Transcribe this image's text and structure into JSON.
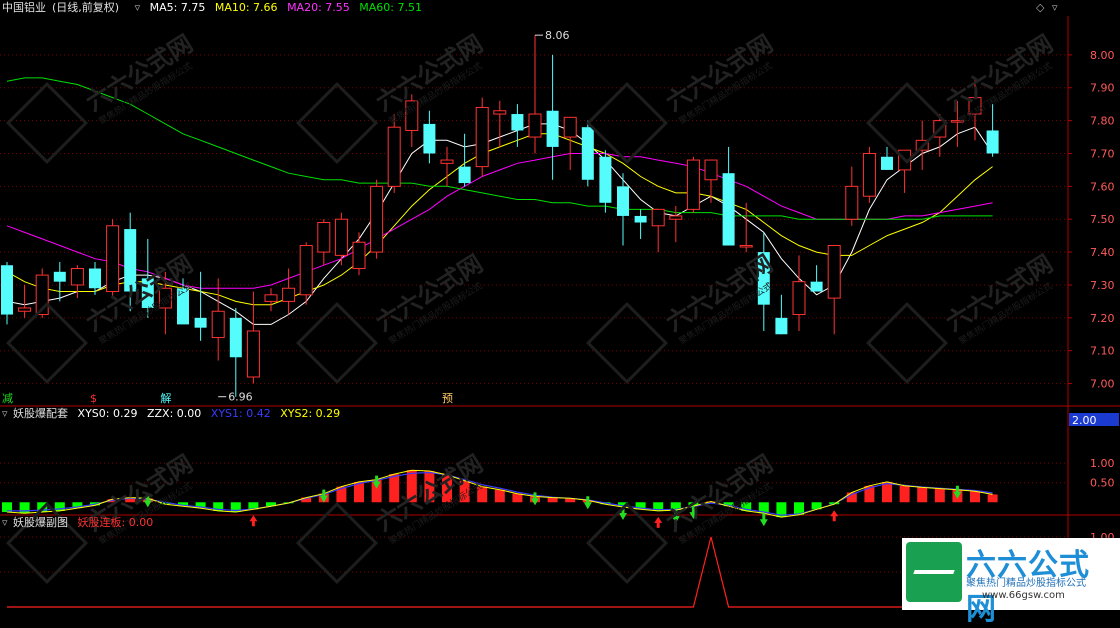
{
  "header": {
    "stock": "中国铝业",
    "period": "(日线,前复权)",
    "ma5_label": "MA5: 7.75",
    "ma10_label": "MA10: 7.66",
    "ma20_label": "MA20: 7.55",
    "ma60_label": "MA60: 7.51"
  },
  "sub1": {
    "name": "妖股爆配套",
    "xys0_label": "XYS0: 0.29",
    "zzx_label": "ZZX: 0.00",
    "xys1_label": "XYS1: 0.42",
    "xys2_label": "XYS2: 0.29",
    "box_value": "2.00"
  },
  "sub2": {
    "name": "妖股爆副图",
    "yaogu_label": "妖股连板: 0.00"
  },
  "markers": {
    "m1": "减",
    "m2": "$",
    "m3": "解",
    "m4": "预"
  },
  "watermark": {
    "text": "六六公式网",
    "sub": "聚焦热门精品炒股指标公式"
  },
  "logo": {
    "title": "六六公式网",
    "subtitle": "聚焦热门精品炒股指标公式",
    "url": "www.66gsw.com"
  },
  "colors": {
    "up": "#ff3232",
    "down": "#54fcfc",
    "ma5": "#ffffff",
    "ma10": "#ffff00",
    "ma20": "#ff00ff",
    "ma60": "#00e000",
    "grid": "#7a0000"
  },
  "chart_data": [
    {
      "type": "candlestick",
      "ylim": [
        6.95,
        8.1
      ],
      "yticks": [
        "8.00",
        "7.90",
        "7.80",
        "7.70",
        "7.60",
        "7.50",
        "7.40",
        "7.30",
        "7.20",
        "7.10",
        "7.00"
      ],
      "ytick_values": [
        8.0,
        7.9,
        7.8,
        7.7,
        7.6,
        7.5,
        7.4,
        7.3,
        7.2,
        7.1,
        7.0
      ],
      "annotations": [
        {
          "label": "8.06",
          "bar": 30,
          "value": 8.06
        },
        {
          "label": "6.96",
          "bar": 12,
          "value": 6.96
        }
      ],
      "ohlc": [
        [
          7.36,
          7.37,
          7.18,
          7.21
        ],
        [
          7.22,
          7.3,
          7.2,
          7.23
        ],
        [
          7.21,
          7.35,
          7.2,
          7.33
        ],
        [
          7.34,
          7.37,
          7.25,
          7.31
        ],
        [
          7.3,
          7.36,
          7.26,
          7.35
        ],
        [
          7.35,
          7.37,
          7.27,
          7.29
        ],
        [
          7.28,
          7.5,
          7.26,
          7.48
        ],
        [
          7.47,
          7.52,
          7.22,
          7.28
        ],
        [
          7.32,
          7.44,
          7.2,
          7.23
        ],
        [
          7.23,
          7.34,
          7.15,
          7.29
        ],
        [
          7.29,
          7.32,
          7.2,
          7.18
        ],
        [
          7.2,
          7.34,
          7.13,
          7.17
        ],
        [
          7.14,
          7.32,
          7.07,
          7.22
        ],
        [
          7.2,
          7.23,
          6.96,
          7.08
        ],
        [
          7.02,
          7.28,
          7.0,
          7.16
        ],
        [
          7.25,
          7.29,
          7.22,
          7.27
        ],
        [
          7.25,
          7.35,
          7.21,
          7.29
        ],
        [
          7.27,
          7.43,
          7.24,
          7.42
        ],
        [
          7.4,
          7.5,
          7.36,
          7.49
        ],
        [
          7.39,
          7.52,
          7.36,
          7.5
        ],
        [
          7.35,
          7.46,
          7.33,
          7.43
        ],
        [
          7.4,
          7.62,
          7.38,
          7.6
        ],
        [
          7.6,
          7.82,
          7.58,
          7.78
        ],
        [
          7.77,
          7.88,
          7.72,
          7.86
        ],
        [
          7.79,
          7.83,
          7.67,
          7.7
        ],
        [
          7.67,
          7.72,
          7.6,
          7.68
        ],
        [
          7.66,
          7.76,
          7.6,
          7.61
        ],
        [
          7.66,
          7.87,
          7.63,
          7.84
        ],
        [
          7.82,
          7.86,
          7.72,
          7.83
        ],
        [
          7.82,
          7.85,
          7.72,
          7.77
        ],
        [
          7.75,
          8.06,
          7.7,
          7.82
        ],
        [
          7.83,
          8.0,
          7.62,
          7.72
        ],
        [
          7.75,
          7.8,
          7.65,
          7.81
        ],
        [
          7.78,
          7.8,
          7.6,
          7.62
        ],
        [
          7.69,
          7.71,
          7.52,
          7.55
        ],
        [
          7.6,
          7.64,
          7.42,
          7.51
        ],
        [
          7.51,
          7.53,
          7.44,
          7.49
        ],
        [
          7.48,
          7.51,
          7.4,
          7.53
        ],
        [
          7.5,
          7.54,
          7.43,
          7.51
        ],
        [
          7.53,
          7.69,
          7.52,
          7.68
        ],
        [
          7.62,
          7.68,
          7.55,
          7.68
        ],
        [
          7.64,
          7.72,
          7.43,
          7.42
        ],
        [
          7.42,
          7.55,
          7.4,
          7.42
        ],
        [
          7.4,
          7.46,
          7.16,
          7.24
        ],
        [
          7.2,
          7.27,
          7.15,
          7.15
        ],
        [
          7.21,
          7.39,
          7.16,
          7.31
        ],
        [
          7.31,
          7.36,
          7.28,
          7.28
        ],
        [
          7.26,
          7.4,
          7.15,
          7.42
        ],
        [
          7.5,
          7.66,
          7.48,
          7.6
        ],
        [
          7.57,
          7.72,
          7.55,
          7.7
        ],
        [
          7.69,
          7.72,
          7.65,
          7.65
        ],
        [
          7.65,
          7.7,
          7.58,
          7.71
        ],
        [
          7.71,
          7.8,
          7.65,
          7.74
        ],
        [
          7.75,
          7.82,
          7.69,
          7.8
        ],
        [
          7.8,
          7.86,
          7.72,
          7.8
        ],
        [
          7.82,
          7.93,
          7.74,
          7.87
        ],
        [
          7.77,
          7.85,
          7.69,
          7.7
        ]
      ],
      "series": [
        {
          "name": "MA5",
          "values": [
            7.25,
            7.24,
            7.25,
            7.26,
            7.28,
            7.28,
            7.31,
            7.33,
            7.33,
            7.32,
            7.3,
            7.28,
            7.25,
            7.22,
            7.18,
            7.18,
            7.21,
            7.25,
            7.32,
            7.38,
            7.44,
            7.52,
            7.61,
            7.7,
            7.74,
            7.74,
            7.72,
            7.73,
            7.75,
            7.77,
            7.79,
            7.79,
            7.77,
            7.73,
            7.68,
            7.62,
            7.56,
            7.52,
            7.51,
            7.54,
            7.57,
            7.54,
            7.5,
            7.46,
            7.38,
            7.32,
            7.27,
            7.3,
            7.4,
            7.53,
            7.62,
            7.66,
            7.7,
            7.72,
            7.76,
            7.78,
            7.7
          ]
        },
        {
          "name": "MA10",
          "values": [
            7.34,
            7.31,
            7.29,
            7.28,
            7.28,
            7.28,
            7.3,
            7.31,
            7.31,
            7.3,
            7.29,
            7.28,
            7.27,
            7.25,
            7.24,
            7.24,
            7.26,
            7.28,
            7.3,
            7.33,
            7.37,
            7.42,
            7.48,
            7.54,
            7.59,
            7.63,
            7.67,
            7.7,
            7.72,
            7.74,
            7.76,
            7.76,
            7.74,
            7.72,
            7.7,
            7.67,
            7.63,
            7.6,
            7.58,
            7.58,
            7.57,
            7.55,
            7.53,
            7.49,
            7.45,
            7.42,
            7.4,
            7.39,
            7.39,
            7.42,
            7.45,
            7.47,
            7.49,
            7.52,
            7.57,
            7.62,
            7.66
          ]
        },
        {
          "name": "MA20",
          "values": [
            7.48,
            7.46,
            7.44,
            7.42,
            7.4,
            7.38,
            7.37,
            7.35,
            7.34,
            7.32,
            7.3,
            7.29,
            7.29,
            7.29,
            7.29,
            7.3,
            7.32,
            7.34,
            7.36,
            7.38,
            7.41,
            7.44,
            7.47,
            7.5,
            7.53,
            7.57,
            7.6,
            7.63,
            7.65,
            7.67,
            7.68,
            7.69,
            7.7,
            7.7,
            7.7,
            7.69,
            7.69,
            7.68,
            7.67,
            7.66,
            7.64,
            7.62,
            7.6,
            7.57,
            7.54,
            7.52,
            7.5,
            7.5,
            7.5,
            7.5,
            7.5,
            7.51,
            7.51,
            7.52,
            7.53,
            7.54,
            7.55
          ]
        },
        {
          "name": "MA60",
          "values": [
            7.92,
            7.93,
            7.93,
            7.92,
            7.91,
            7.89,
            7.87,
            7.85,
            7.82,
            7.79,
            7.76,
            7.74,
            7.72,
            7.7,
            7.68,
            7.66,
            7.64,
            7.63,
            7.62,
            7.62,
            7.61,
            7.61,
            7.61,
            7.61,
            7.6,
            7.6,
            7.59,
            7.58,
            7.57,
            7.56,
            7.56,
            7.55,
            7.55,
            7.54,
            7.54,
            7.53,
            7.53,
            7.53,
            7.52,
            7.52,
            7.52,
            7.51,
            7.51,
            7.51,
            7.51,
            7.5,
            7.5,
            7.5,
            7.5,
            7.5,
            7.5,
            7.5,
            7.5,
            7.51,
            7.51,
            7.51,
            7.51
          ]
        }
      ]
    },
    {
      "type": "bar",
      "ylim": [
        -0.3,
        2.0
      ],
      "yticks": [
        "1.00",
        "0.50"
      ],
      "ytick_values": [
        1.0,
        0.5
      ],
      "values": [
        -0.25,
        -0.28,
        -0.25,
        -0.22,
        -0.15,
        -0.08,
        0.08,
        0.12,
        0.1,
        -0.05,
        -0.1,
        -0.15,
        -0.22,
        -0.25,
        -0.18,
        -0.1,
        -0.02,
        0.12,
        0.22,
        0.4,
        0.52,
        0.58,
        0.72,
        0.82,
        0.8,
        0.7,
        0.55,
        0.4,
        0.32,
        0.22,
        0.15,
        0.12,
        0.1,
        0.05,
        -0.05,
        -0.12,
        -0.18,
        -0.22,
        -0.2,
        -0.1,
        0.02,
        -0.1,
        -0.22,
        -0.28,
        -0.38,
        -0.32,
        -0.18,
        -0.05,
        0.25,
        0.42,
        0.52,
        0.42,
        0.38,
        0.35,
        0.32,
        0.28,
        0.2
      ],
      "series": [
        {
          "name": "XYS1",
          "values": [
            -0.22,
            -0.22,
            -0.2,
            -0.17,
            -0.12,
            -0.05,
            0.05,
            0.1,
            0.08,
            0.0,
            -0.08,
            -0.12,
            -0.18,
            -0.21,
            -0.17,
            -0.1,
            -0.02,
            0.1,
            0.2,
            0.35,
            0.48,
            0.56,
            0.66,
            0.74,
            0.76,
            0.7,
            0.58,
            0.45,
            0.36,
            0.26,
            0.18,
            0.13,
            0.1,
            0.06,
            -0.02,
            -0.09,
            -0.15,
            -0.19,
            -0.18,
            -0.11,
            -0.02,
            -0.08,
            -0.18,
            -0.25,
            -0.33,
            -0.3,
            -0.18,
            -0.04,
            0.2,
            0.37,
            0.48,
            0.43,
            0.39,
            0.36,
            0.33,
            0.3,
            0.24
          ]
        }
      ],
      "down_arrows": [
        8,
        18,
        21,
        30,
        33,
        35,
        38,
        39,
        43,
        54
      ],
      "up_arrows": [
        14,
        37,
        47
      ]
    },
    {
      "type": "line",
      "ylim": [
        0,
        1.1
      ],
      "yticks": [
        "1.00",
        "0.50"
      ],
      "ytick_values": [
        1.0,
        0.5
      ],
      "series": [
        {
          "name": "妖股连板",
          "values": [
            0,
            0,
            0,
            0,
            0,
            0,
            0,
            0,
            0,
            0,
            0,
            0,
            0,
            0,
            0,
            0,
            0,
            0,
            0,
            0,
            0,
            0,
            0,
            0,
            0,
            0,
            0,
            0,
            0,
            0,
            0,
            0,
            0,
            0,
            0,
            0,
            0,
            0,
            0,
            0,
            1,
            0,
            0,
            0,
            0,
            0,
            0,
            0,
            0,
            0,
            0,
            0,
            0,
            0,
            0,
            0,
            0
          ]
        }
      ]
    }
  ]
}
